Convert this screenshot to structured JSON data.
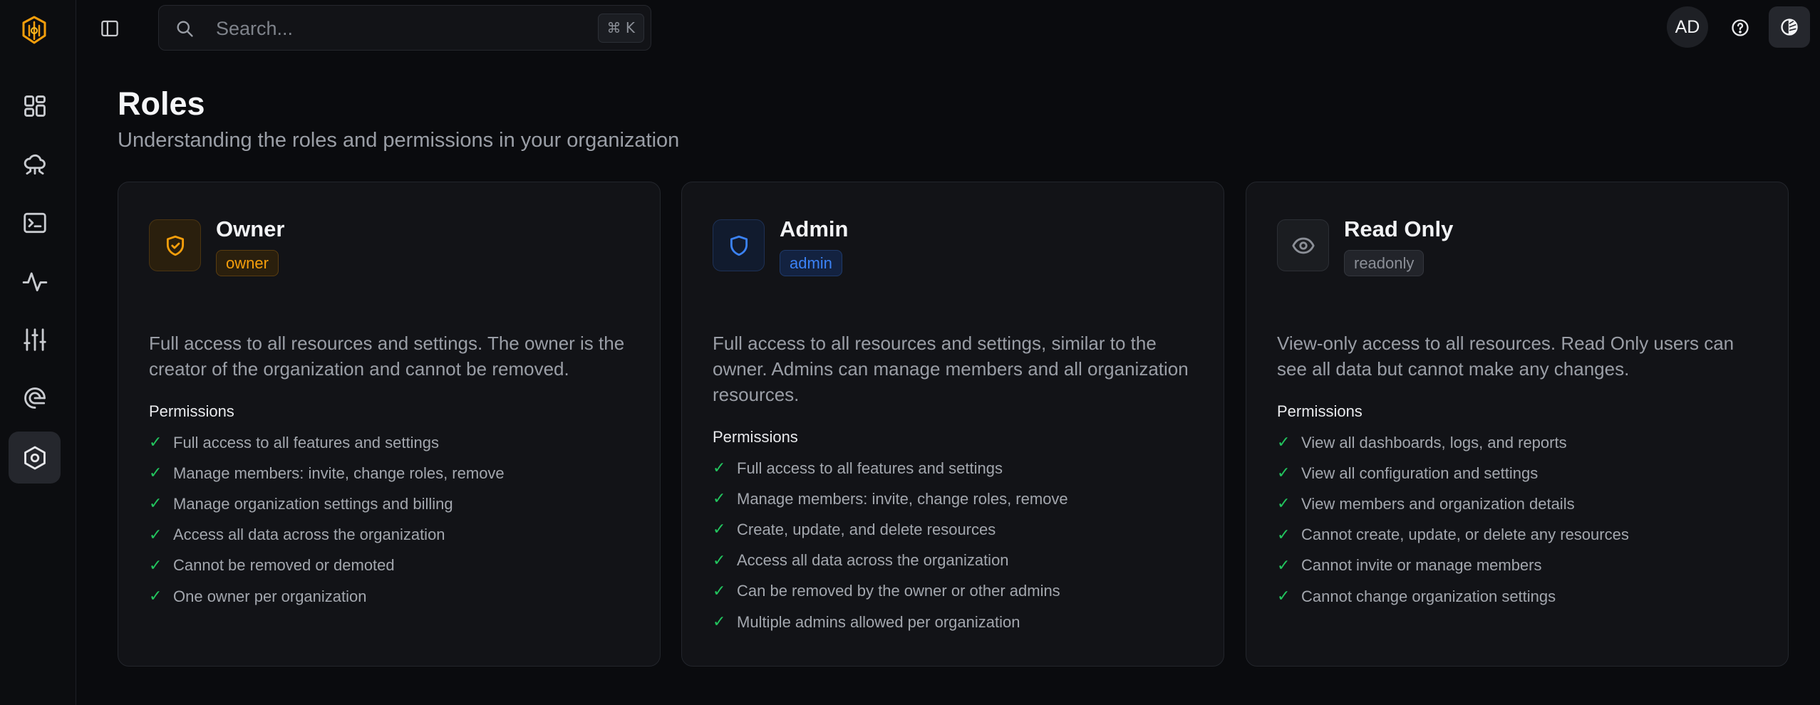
{
  "topbar": {
    "search_placeholder": "Search...",
    "search_shortcut": "⌘ K",
    "avatar_initials": "AD"
  },
  "sidebar": {
    "items": [
      {
        "icon": "dashboard-icon"
      },
      {
        "icon": "cloud-network-icon"
      },
      {
        "icon": "terminal-icon"
      },
      {
        "icon": "activity-icon"
      },
      {
        "icon": "sliders-icon"
      },
      {
        "icon": "fingerprint-icon"
      },
      {
        "icon": "roles-hexagon-icon",
        "active": true
      }
    ]
  },
  "page": {
    "title": "Roles",
    "subtitle": "Understanding the roles and permissions in your organization"
  },
  "roles": [
    {
      "name": "Owner",
      "badge": "owner",
      "accent": "#f59e0b",
      "description": "Full access to all resources and settings. The owner is the creator of the organization and cannot be removed.",
      "permissions_title": "Permissions",
      "permissions": [
        "Full access to all features and settings",
        "Manage members: invite, change roles, remove",
        "Manage organization settings and billing",
        "Access all data across the organization",
        "Cannot be removed or demoted",
        "One owner per organization"
      ]
    },
    {
      "name": "Admin",
      "badge": "admin",
      "accent": "#3b82f6",
      "description": "Full access to all resources and settings, similar to the owner. Admins can manage members and all organization resources.",
      "permissions_title": "Permissions",
      "permissions": [
        "Full access to all features and settings",
        "Manage members: invite, change roles, remove",
        "Create, update, and delete resources",
        "Access all data across the organization",
        "Can be removed by the owner or other admins",
        "Multiple admins allowed per organization"
      ]
    },
    {
      "name": "Read Only",
      "badge": "readonly",
      "accent": "#8b8f97",
      "description": "View-only access to all resources. Read Only users can see all data but cannot make any changes.",
      "permissions_title": "Permissions",
      "permissions": [
        "View all dashboards, logs, and reports",
        "View all configuration and settings",
        "View members and organization details",
        "Cannot create, update, or delete any resources",
        "Cannot invite or manage members",
        "Cannot change organization settings"
      ]
    }
  ]
}
